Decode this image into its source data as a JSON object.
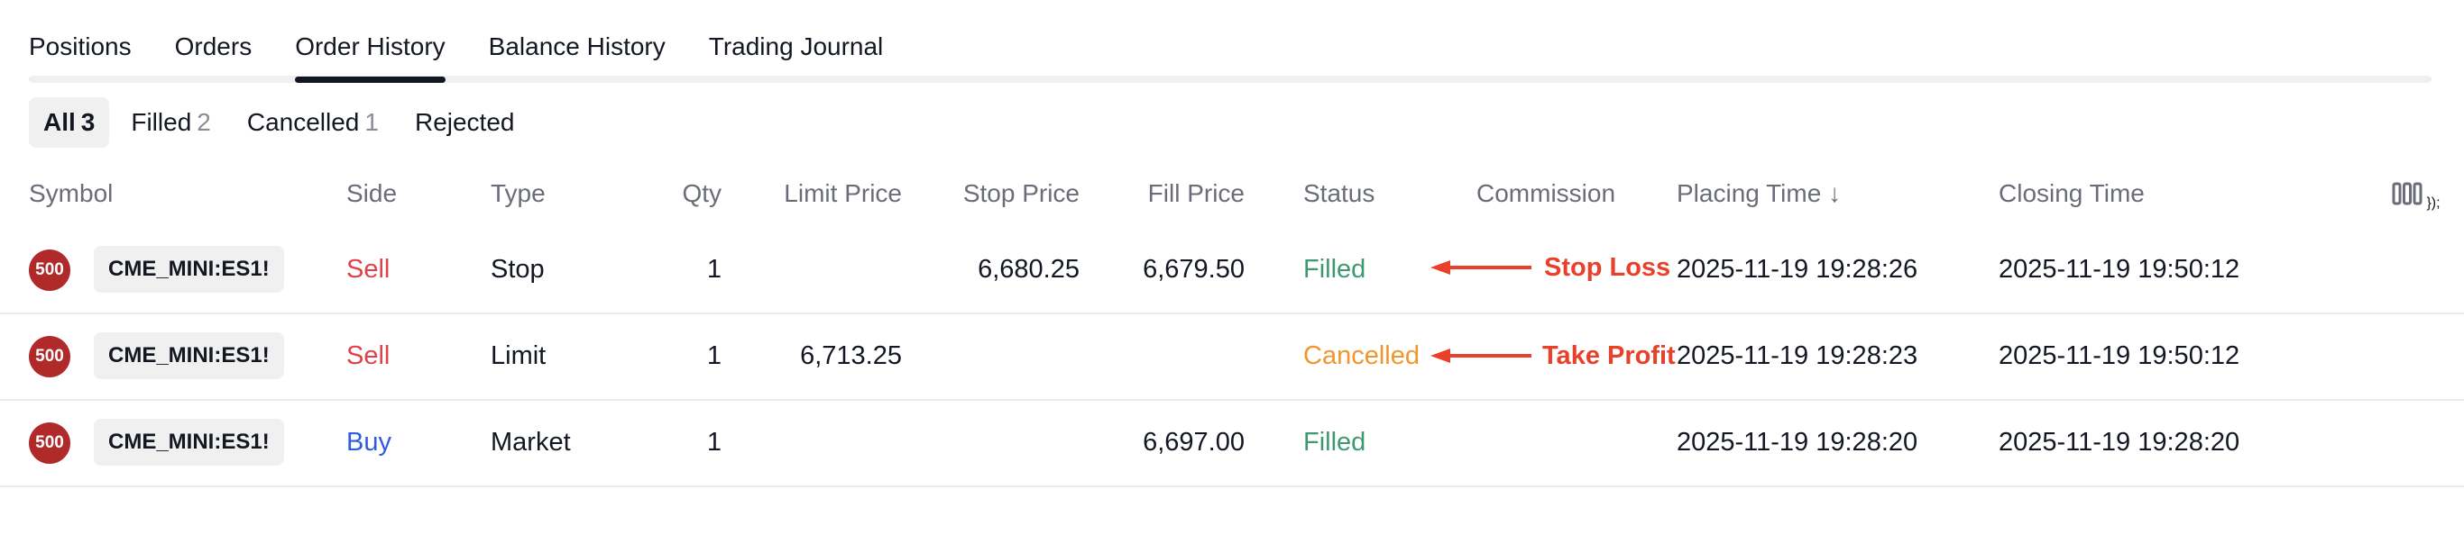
{
  "tabs": [
    "Positions",
    "Orders",
    "Order History",
    "Balance History",
    "Trading Journal"
  ],
  "filters": [
    {
      "label": "All",
      "count": "3"
    },
    {
      "label": "Filled",
      "count": "2"
    },
    {
      "label": "Cancelled",
      "count": "1"
    },
    {
      "label": "Rejected",
      "count": ""
    }
  ],
  "columns": {
    "symbol": "Symbol",
    "side": "Side",
    "type": "Type",
    "qty": "Qty",
    "limit_price": "Limit Price",
    "stop_price": "Stop Price",
    "fill_price": "Fill Price",
    "status": "Status",
    "commission": "Commission",
    "placing_time": "Placing Time ↓",
    "closing_time": "Closing Time"
  },
  "rows": [
    {
      "badge": "500",
      "symbol": "CME_MINI:ES1!",
      "side": "Sell",
      "type": "Stop",
      "qty": "1",
      "limit_price": "",
      "stop_price": "6,680.25",
      "fill_price": "6,679.50",
      "status": "Filled",
      "annotation": "Stop Loss",
      "placing_time": "2025-11-19 19:28:26",
      "closing_time": "2025-11-19 19:50:12"
    },
    {
      "badge": "500",
      "symbol": "CME_MINI:ES1!",
      "side": "Sell",
      "type": "Limit",
      "qty": "1",
      "limit_price": "6,713.25",
      "stop_price": "",
      "fill_price": "",
      "status": "Cancelled",
      "annotation": "Take Profit",
      "placing_time": "2025-11-19 19:28:23",
      "closing_time": "2025-11-19 19:50:12"
    },
    {
      "badge": "500",
      "symbol": "CME_MINI:ES1!",
      "side": "Buy",
      "type": "Market",
      "qty": "1",
      "limit_price": "",
      "stop_price": "",
      "fill_price": "6,697.00",
      "status": "Filled",
      "annotation": "",
      "placing_time": "2025-11-19 19:28:20",
      "closing_time": "2025-11-19 19:28:20"
    }
  ],
  "colors": {
    "sell": "#e0424b",
    "buy": "#2f5ce0",
    "filled": "#3d9970",
    "cancelled": "#f0962c",
    "annotation": "#e8402a",
    "badge": "#b02a2a"
  },
  "icons": {
    "column_settings": "columns-icon",
    "annotation_arrow": "arrow-left-icon"
  }
}
